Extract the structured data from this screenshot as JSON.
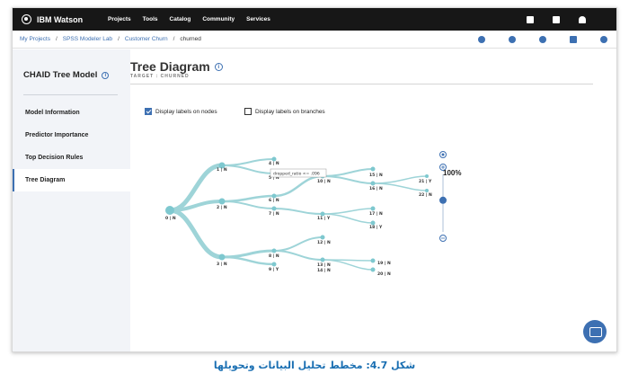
{
  "topbar": {
    "brand": "IBM Watson",
    "nav": [
      "Projects",
      "Tools",
      "Catalog",
      "Community",
      "Services"
    ],
    "icons": [
      "document-icon",
      "grid-icon",
      "bell-icon"
    ]
  },
  "breadcrumb": {
    "items": [
      "My Projects",
      "SPSS Modeler Lab",
      "Customer Churn"
    ],
    "current": "churned",
    "icons": [
      "info-icon",
      "flow-icon",
      "settings-icon",
      "layout-icon",
      "check-icon"
    ]
  },
  "sidebar": {
    "title": "CHAID Tree Model",
    "items": [
      {
        "label": "Model Information",
        "active": false
      },
      {
        "label": "Predictor Importance",
        "active": false
      },
      {
        "label": "Top Decision Rules",
        "active": false
      },
      {
        "label": "Tree Diagram",
        "active": true
      }
    ]
  },
  "main": {
    "title": "Tree Diagram",
    "subtitle": "TARGET : CHURNED",
    "checkbox_nodes": {
      "label": "Display labels on nodes",
      "checked": true
    },
    "checkbox_branches": {
      "label": "Display labels on branches",
      "checked": false
    },
    "tooltip": "dropped_ratio <= .096",
    "zoom": "100%",
    "zoom_level": 0.55,
    "nodes": {
      "n0": "0 | N",
      "n1": "1 | N",
      "n2": "2 | N",
      "n3": "3 | N",
      "n4": "4 | N",
      "n5": "5 | N",
      "n6": "6 | N",
      "n7": "7 | N",
      "n8": "8 | N",
      "n9": "9 | Y",
      "n10": "10 | N",
      "n11": "11 | Y",
      "n12": "12 | N",
      "n13": "13 | N",
      "n14": "14 | N",
      "n15": "15 | N",
      "n16": "16 | N",
      "n17": "17 | N",
      "n18": "18 | Y",
      "n19": "19 | N",
      "n20": "20 | N",
      "n21": "21 | Y",
      "n22": "22 | N"
    }
  },
  "caption": "شكل 4.7: مخطط تحليل البيانات وتحويلها",
  "colors": {
    "topbar": "#171717",
    "accent": "#3d70b2",
    "tree_link": "#9ed4d8",
    "tree_node": "#7ec8cf",
    "caption": "#1a6fb2"
  }
}
